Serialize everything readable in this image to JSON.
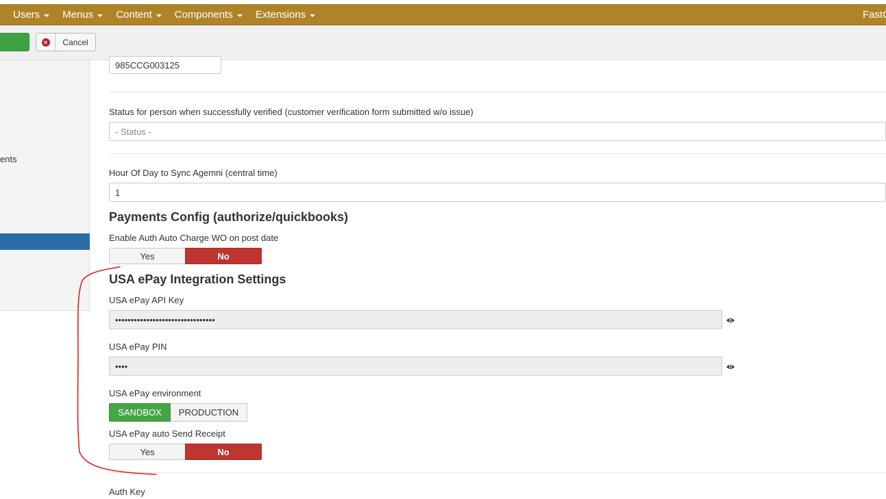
{
  "navbar": {
    "menus": [
      {
        "label": "Users"
      },
      {
        "label": "Menus"
      },
      {
        "label": "Content"
      },
      {
        "label": "Components"
      },
      {
        "label": "Extensions"
      }
    ],
    "brand_partial": "FastC"
  },
  "toolbar": {
    "cancel_label": "Cancel"
  },
  "sidebar": {
    "partial_text": "ents"
  },
  "form": {
    "top_value": "985CCG003125",
    "status_label": "Status for person when successfully verified (customer verification form submitted w/o issue)",
    "status_placeholder": "- Status -",
    "sync_label": "Hour Of Day to Sync Agemni (central time)",
    "sync_value": "1",
    "payments_title": "Payments Config (authorize/quickbooks)",
    "auto_charge_label": "Enable Auth Auto Charge WO on post date",
    "auto_charge": {
      "yes": "Yes",
      "no": "No",
      "selected": "No"
    },
    "usaepay_title": "USA ePay Integration Settings",
    "api_key_label": "USA ePay API Key",
    "api_key_value": "••••••••••••••••••••••••••••••••",
    "pin_label": "USA ePay PIN",
    "pin_value": "••••",
    "env_label": "USA ePay environment",
    "env": {
      "sandbox": "SANDBOX",
      "production": "PRODUCTION",
      "selected": "SANDBOX"
    },
    "receipt_label": "USA ePay auto Send Receipt",
    "receipt": {
      "yes": "Yes",
      "no": "No",
      "selected": "No"
    },
    "auth_key_label": "Auth Key"
  },
  "colors": {
    "navbar": "#af8428",
    "save_green": "#3ea243",
    "toggle_red": "#bd362f",
    "sandbox_green": "#46a546",
    "sidebar_active": "#2d6ca8",
    "annotation_red": "#e0201b"
  }
}
